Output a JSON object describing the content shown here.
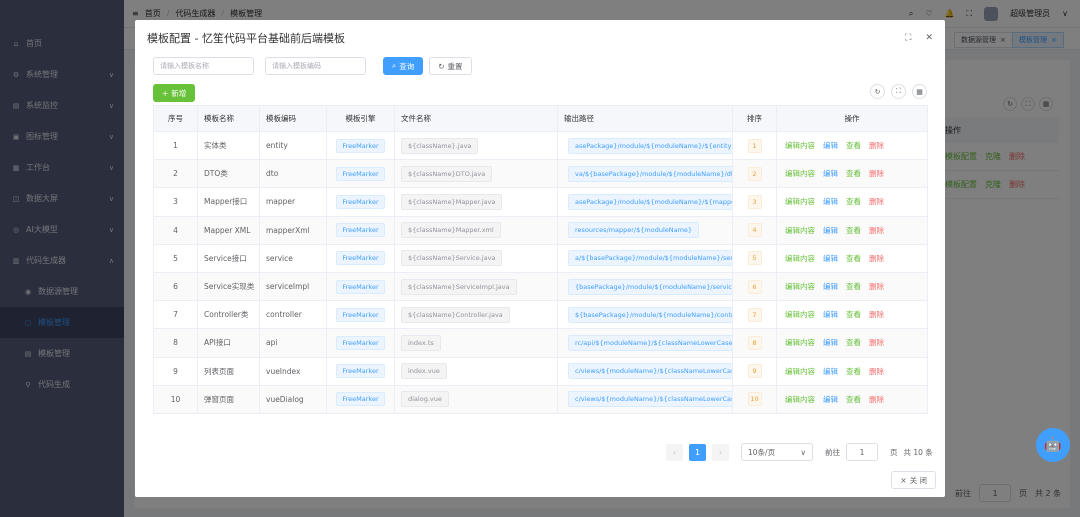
{
  "sidebar": {
    "items": [
      {
        "icon": "⌂",
        "label": "首页"
      },
      {
        "icon": "⚙",
        "label": "系统管理",
        "chev": "∨"
      },
      {
        "icon": "▤",
        "label": "系统监控",
        "chev": "∨"
      },
      {
        "icon": "▣",
        "label": "图标管理",
        "chev": "∨"
      },
      {
        "icon": "▦",
        "label": "工作台",
        "chev": "∨"
      },
      {
        "icon": "◫",
        "label": "数据大屏",
        "chev": "∨"
      },
      {
        "icon": "◎",
        "label": "AI大模型",
        "chev": "∨"
      },
      {
        "icon": "▥",
        "label": "代码生成器",
        "chev": "∧"
      }
    ],
    "sub_items": [
      {
        "icon": "◉",
        "label": "数据源管理"
      },
      {
        "icon": "▢",
        "label": "模板管理"
      },
      {
        "icon": "▤",
        "label": "模板管理"
      },
      {
        "icon": "⚲",
        "label": "代码生成"
      }
    ]
  },
  "topbar": {
    "menu_icon": "≡",
    "breadcrumb": [
      "首页",
      "代码生成器",
      "模板管理"
    ],
    "sep": "/",
    "icons": [
      "⌕",
      "♡",
      "🔔",
      "⛶"
    ],
    "username": "超级管理员",
    "user_chev": "∨"
  },
  "tabs": [
    {
      "label": "数据源管理",
      "close": "×"
    },
    {
      "label": "模板管理",
      "close": "×"
    }
  ],
  "bg_page": {
    "col_header": "操作",
    "rows": [
      [
        "模板配置",
        "克隆",
        "删除"
      ],
      [
        "模板配置",
        "克隆",
        "删除"
      ]
    ],
    "tool_icons": [
      "↻",
      "⛶",
      "▦"
    ],
    "pager": {
      "goto": "前往",
      "page": "1",
      "unit": "页",
      "total": "共 2 条"
    }
  },
  "dialog": {
    "title": "模板配置 - 忆笙代码平台基础前后端模板",
    "maximize_icon": "⛶",
    "close_icon": "✕",
    "search": {
      "name_placeholder": "请输入模板名称",
      "code_placeholder": "请输入模板编码",
      "query_icon": "⌕",
      "query_label": "查询",
      "reset_icon": "↻",
      "reset_label": "重置"
    },
    "add_icon": "+",
    "add_label": "新增",
    "tool_icons": [
      "↻",
      "⛶",
      "▦"
    ],
    "columns": [
      "序号",
      "模板名称",
      "模板编码",
      "模板引擎",
      "文件名称",
      "输出路径",
      "排序",
      "操作"
    ],
    "rows": [
      {
        "idx": "1",
        "name": "实体类",
        "code": "entity",
        "engine": "FreeMarker",
        "file": "${className}.java",
        "path": "asePackage}/module/${moduleName}/${entityP",
        "sort": "1"
      },
      {
        "idx": "2",
        "name": "DTO类",
        "code": "dto",
        "engine": "FreeMarker",
        "file": "${className}DTO.java",
        "path": "va/${basePackage}/module/${moduleName}/dt",
        "sort": "2"
      },
      {
        "idx": "3",
        "name": "Mapper接口",
        "code": "mapper",
        "engine": "FreeMarker",
        "file": "${className}Mapper.java",
        "path": "asePackage}/module/${moduleName}/${mapper",
        "sort": "3"
      },
      {
        "idx": "4",
        "name": "Mapper XML",
        "code": "mapperXml",
        "engine": "FreeMarker",
        "file": "${className}Mapper.xml",
        "path": "resources/mapper/${moduleName}",
        "sort": "4"
      },
      {
        "idx": "5",
        "name": "Service接口",
        "code": "service",
        "engine": "FreeMarker",
        "file": "${className}Service.java",
        "path": "a/${basePackage}/module/${moduleName}/serv",
        "sort": "5"
      },
      {
        "idx": "6",
        "name": "Service实现类",
        "code": "serviceImpl",
        "engine": "FreeMarker",
        "file": "${className}ServiceImpl.java",
        "path": "{basePackage}/module/${moduleName}/servic",
        "sort": "6"
      },
      {
        "idx": "7",
        "name": "Controller类",
        "code": "controller",
        "engine": "FreeMarker",
        "file": "${className}Controller.java",
        "path": "${basePackage}/module/${moduleName}/contr",
        "sort": "7"
      },
      {
        "idx": "8",
        "name": "API接口",
        "code": "api",
        "engine": "FreeMarker",
        "file": "index.ts",
        "path": "rc/api/${moduleName}/${classNameLowerCase",
        "sort": "8"
      },
      {
        "idx": "9",
        "name": "列表页面",
        "code": "vueIndex",
        "engine": "FreeMarker",
        "file": "index.vue",
        "path": "c/views/${moduleName}/${classNameLowerCas",
        "sort": "9"
      },
      {
        "idx": "10",
        "name": "弹窗页面",
        "code": "vueDialog",
        "engine": "FreeMarker",
        "file": "dialog.vue",
        "path": "c/views/${moduleName}/${classNameLowerCas",
        "sort": "10"
      }
    ],
    "actions": [
      "编辑内容",
      "编辑",
      "查看",
      "删除"
    ],
    "pager": {
      "prev": "‹",
      "page": "1",
      "next": "›",
      "size": "10条/页",
      "size_chev": "∨",
      "goto": "前往",
      "goto_value": "1",
      "unit": "页",
      "total": "共 10 条"
    },
    "close_label": "关 闭",
    "close_btn_icon": "×"
  },
  "assistant_icon": "🤖"
}
